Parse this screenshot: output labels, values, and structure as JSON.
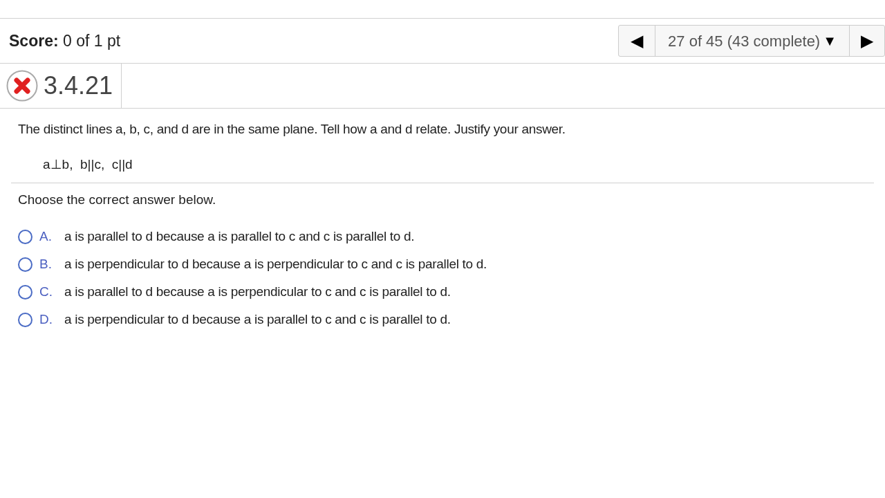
{
  "score": {
    "label": "Score:",
    "value": "0 of 1 pt"
  },
  "navigator": {
    "prev": "◀",
    "position": "27 of 45 (43 complete)",
    "dropdown": "▼",
    "next": "▶"
  },
  "question": {
    "number": "3.4.21",
    "correct": false
  },
  "prompt": "The distinct lines a, b, c, and d are in the same plane. Tell how a and d relate. Justify your answer.",
  "relations": "a⊥b,  b||c,  c||d",
  "instruction": "Choose the correct answer below.",
  "options": [
    {
      "letter": "A.",
      "text": "a is parallel to d because a is parallel to c and c is parallel to d.",
      "selected": false
    },
    {
      "letter": "B.",
      "text": "a is perpendicular to d because a is perpendicular to c and c is parallel to d.",
      "selected": false
    },
    {
      "letter": "C.",
      "text": "a is parallel to d because a is perpendicular to c and c is parallel to d.",
      "selected": false
    },
    {
      "letter": "D.",
      "text": "a is perpendicular to d because a is parallel to c and c is parallel to d.",
      "selected": false
    }
  ]
}
